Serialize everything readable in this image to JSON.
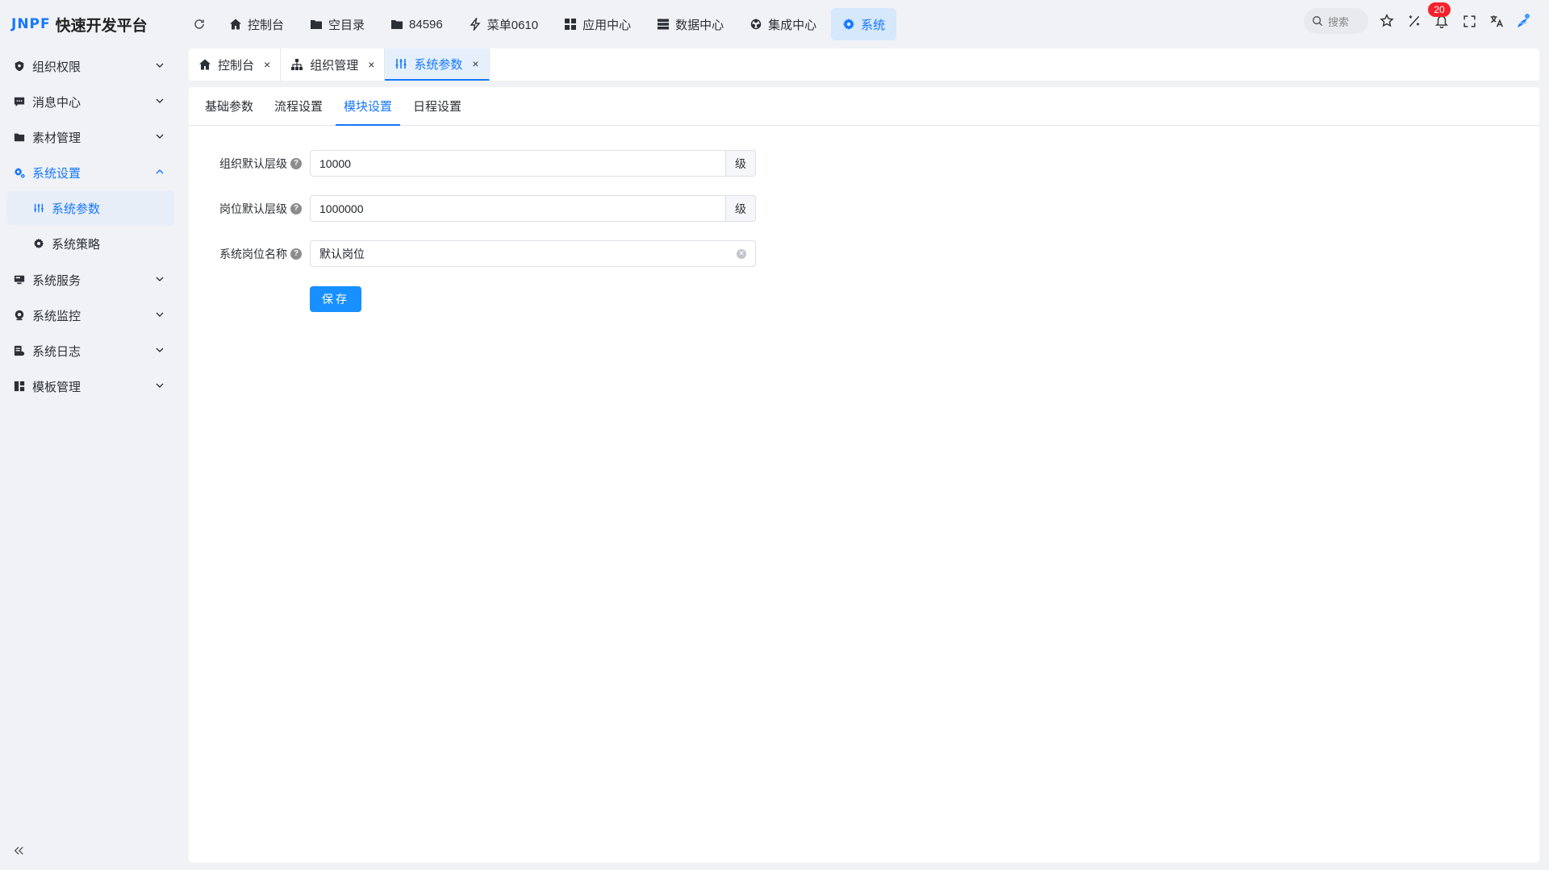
{
  "app": {
    "logo_mark": "JNPF",
    "title": "快速开发平台"
  },
  "topnav": [
    {
      "label": "控制台",
      "icon": "home-icon"
    },
    {
      "label": "空目录",
      "icon": "folder-icon"
    },
    {
      "label": "84596",
      "icon": "folder-icon"
    },
    {
      "label": "菜单0610",
      "icon": "lightning-icon"
    },
    {
      "label": "应用中心",
      "icon": "apps-icon"
    },
    {
      "label": "数据中心",
      "icon": "database-icon"
    },
    {
      "label": "集成中心",
      "icon": "integration-icon"
    },
    {
      "label": "系统",
      "icon": "gear-icon",
      "active": true
    }
  ],
  "toolbar": {
    "search_placeholder": "搜索",
    "notification_count": "20"
  },
  "sidebar": {
    "items": [
      {
        "label": "组织权限",
        "icon": "shield-icon"
      },
      {
        "label": "消息中心",
        "icon": "message-icon"
      },
      {
        "label": "素材管理",
        "icon": "folder-icon"
      },
      {
        "label": "系统设置",
        "icon": "settings-icon",
        "open": true
      },
      {
        "label": "系统服务",
        "icon": "server-icon"
      },
      {
        "label": "系统监控",
        "icon": "monitor-icon"
      },
      {
        "label": "系统日志",
        "icon": "log-icon"
      },
      {
        "label": "模板管理",
        "icon": "template-icon"
      }
    ],
    "sub_items": [
      {
        "label": "系统参数",
        "icon": "sliders-icon",
        "active": true
      },
      {
        "label": "系统策略",
        "icon": "gear-icon"
      }
    ]
  },
  "page_tabs": [
    {
      "label": "控制台",
      "icon": "home-icon",
      "close": "×"
    },
    {
      "label": "组织管理",
      "icon": "org-icon",
      "close": "×"
    },
    {
      "label": "系统参数",
      "icon": "sliders-icon",
      "close": "×",
      "active": true
    }
  ],
  "subtabs": [
    {
      "label": "基础参数"
    },
    {
      "label": "流程设置"
    },
    {
      "label": "模块设置",
      "active": true
    },
    {
      "label": "日程设置"
    }
  ],
  "form": {
    "org_level": {
      "label": "组织默认层级",
      "value": "10000",
      "unit": "级"
    },
    "post_level": {
      "label": "岗位默认层级",
      "value": "1000000",
      "unit": "级"
    },
    "post_name": {
      "label": "系统岗位名称",
      "value": "默认岗位"
    },
    "save_label": "保存",
    "help_glyph": "?"
  },
  "colors": {
    "accent": "#1677ff",
    "badge": "#f5222d",
    "active_bg": "#d6e8fb"
  }
}
